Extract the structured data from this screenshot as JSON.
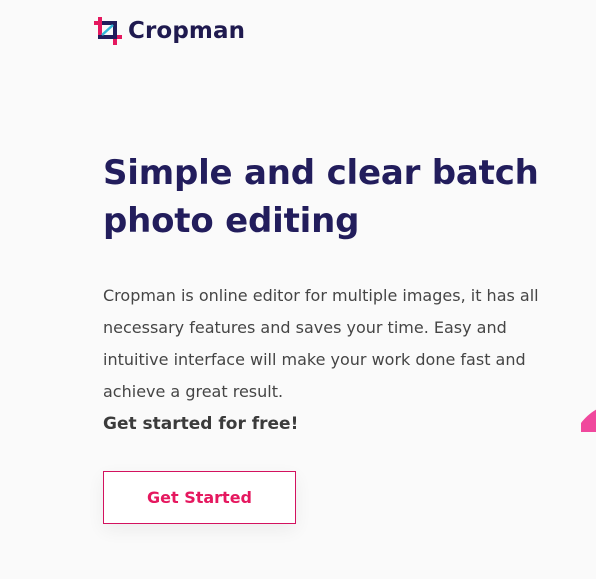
{
  "header": {
    "logo_text": "Cropman",
    "logo_icon": "crop-icon"
  },
  "hero": {
    "title": "Simple and clear batch photo editing",
    "description": "Cropman is online editor for multiple images, it has all necessary features and saves your time. Easy and intuitive interface will make your work done fast and achieve a great result.",
    "cta_text": "Get started for free!",
    "button_label": "Get Started"
  },
  "colors": {
    "brand_dark": "#221d5c",
    "accent_pink": "#e5185f",
    "text_gray": "#454545",
    "background": "#fafafa"
  }
}
